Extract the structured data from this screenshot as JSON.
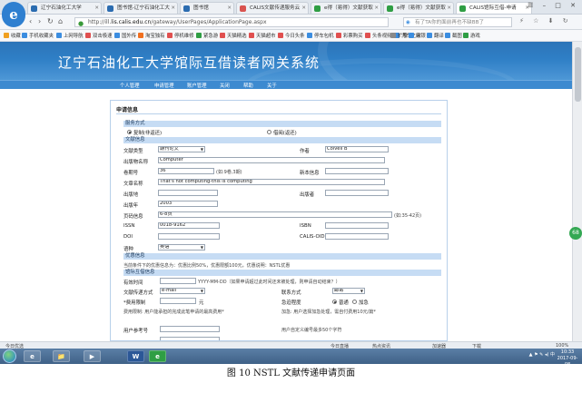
{
  "browser": {
    "logo_letter": "e",
    "tabs": [
      {
        "label": "辽宁石油化工大学",
        "color": "#2b6cb0"
      },
      {
        "label": "图书馆-辽宁石油化工大",
        "color": "#2b6cb0"
      },
      {
        "label": "图书馆",
        "color": "#2b6cb0"
      },
      {
        "label": "CALIS文献传递服务云",
        "color": "#d9534f"
      },
      {
        "label": "e得（易得）文献获取",
        "color": "#2f9e44"
      },
      {
        "label": "e得（易得）文献获取",
        "color": "#2f9e44"
      },
      {
        "label": "CALIS馆际互借-申请",
        "color": "#2f9e44",
        "active": true
      }
    ],
    "url_prefix": "http://ill.",
    "url_host": "lis.calis.edu.cn",
    "url_path": "/gateway/UserPages/ApplicationPage.aspx",
    "search_placeholder": "有了TA你的面前再也不缺BB了",
    "window_controls": "☰ – □ ✕",
    "addr_icons": "⚡ ☆ ⬇ ↻",
    "bookmarks": [
      {
        "label": "收藏",
        "color": "#f0a020"
      },
      {
        "label": "手机收藏夹",
        "color": "#3b8de0"
      },
      {
        "label": "上网导航",
        "color": "#3b8de0"
      },
      {
        "label": "双击极速",
        "color": "#e05050"
      },
      {
        "label": "国外传",
        "color": "#3b8de0"
      },
      {
        "label": "淘宝独有",
        "color": "#f07020"
      },
      {
        "label": "停机维修",
        "color": "#e05050"
      },
      {
        "label": "紧急游",
        "color": "#2f9e44"
      },
      {
        "label": "天猫精选",
        "color": "#e05050"
      },
      {
        "label": "天猫超市",
        "color": "#e05050"
      },
      {
        "label": "今日头条",
        "color": "#e05050"
      },
      {
        "label": "停车包机",
        "color": "#3b8de0"
      },
      {
        "label": "彩票购买",
        "color": "#e05050"
      },
      {
        "label": "头条视频",
        "color": "#e05050"
      },
      {
        "label": "汽车之家",
        "color": "#3b8de0"
      },
      {
        "label": "扩展",
        "color": "#8a8a8a"
      },
      {
        "label": "网银",
        "color": "#3b8de0"
      },
      {
        "label": "翻译",
        "color": "#3b8de0"
      },
      {
        "label": "截图",
        "color": "#3b8de0"
      },
      {
        "label": "游戏",
        "color": "#2f9e44"
      }
    ]
  },
  "site": {
    "banner_title": "辽宁石油化工大学馆际互借读者网关系统",
    "menu": [
      "个人管理",
      "申请管理",
      "账户管理",
      "关闭",
      "帮助",
      "关于"
    ],
    "side_badge": "68"
  },
  "form": {
    "heading": "申请信息",
    "sections": {
      "service": "服务方式",
      "doc_info": "文献信息",
      "preference": "优惠信息",
      "ill_info": "馆际互借信息"
    },
    "service_options": [
      "复制(非返还)",
      "借阅(返还)"
    ],
    "doc_type_label": "文献类型",
    "doc_type_value": "期刊论文",
    "author_label": "作者",
    "author_value": "Colvell B",
    "source_label": "出版物名称",
    "source_value": "Computer",
    "volume_label": "卷期号",
    "volume_value": "36",
    "volume_hint": "(如:9卷,3期)",
    "new_info_label": "新本信息",
    "article_label": "文章名称",
    "article_value": "That's not computing-this is computing",
    "place_label": "出版地",
    "publisher_label": "出版者",
    "year_label": "出版年",
    "year_value": "2003",
    "pages_label": "页码信息",
    "pages_value": "6-8页",
    "pages_hint": "(如:35-42页)",
    "issn_label": "ISSN",
    "issn_value": "0018-9162",
    "isbn_label": "ISBN",
    "doi_label": "DOI",
    "calis_label": "CALIS-OID",
    "lang_label": "语种",
    "lang_value": "英语",
    "preference_note": "当前条件下的优惠信息为：优惠比例50%，优惠限额100元，优惠说明：NSTL优惠",
    "valid_label": "有效时间",
    "valid_hint": "YYYY-MM-DD（如果申请超过此时间还未被处理，则申请自动结束？）",
    "delivery_label": "文献传递方式",
    "delivery_value": "e-mail",
    "contact_label": "联系方式",
    "contact_value": "邮寄",
    "fee_label": "*费用限制",
    "fee_unit": "元",
    "urgency_label": "急迫程度",
    "urgency_options": [
      "普通",
      "加急"
    ],
    "fee_note": "费用限制: 用户能承担的完成此笔申请的最高费用*",
    "urgent_note": "加急: 用户选择加急处理，需自付费用10元/篇*",
    "user_ref_label": "用户参考号",
    "user_note_label": "用户自定义编号最多50个字符"
  },
  "status": {
    "left": "今日优选",
    "mid1": "今日直播",
    "mid2": "热点资讯",
    "right1": "加速器",
    "right2": "下载",
    "zoom": "100%"
  },
  "taskbar": {
    "apps": [
      "e",
      "📁",
      "▶",
      "W",
      "e"
    ],
    "tray": "▲ ⚑ ✎ ◂) 中",
    "time": "10:33",
    "date": "2017-09-08"
  },
  "caption": "图 10    NSTL 文献传递申请页面"
}
